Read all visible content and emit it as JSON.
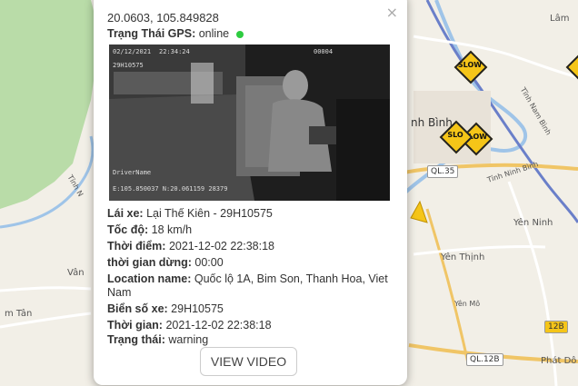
{
  "map": {
    "labels": {
      "lam": "Lâm",
      "binh": "nh Bình",
      "tinh_nam_binh": "Tĩnh Nam Bình",
      "tinh_ninh_binh": "Tỉnh Ninh Bình",
      "tinh_n": "Tỉnh N",
      "yen_ninh": "Yên Ninh",
      "yen_thinh": "Yên Thịnh",
      "van": "Vân",
      "m_tan": "m Tân",
      "yen_mo": "Yên Mô",
      "phat_do": "Phát Dô"
    },
    "roads": {
      "ql35": "QL.35",
      "ql12b": "QL.12B",
      "ql12b_short": "QL.12B"
    },
    "signs": {
      "slow1": "SLOW",
      "slow2": "SLOW",
      "slow3": "SLO"
    }
  },
  "popup": {
    "coords": "20.0603, 105.849828",
    "gps_label": "Trạng Thái GPS:",
    "gps_value": "online",
    "camera": {
      "date": "02/12/2021",
      "time": "22:34:24",
      "channel": "00004",
      "plate": "29H10575",
      "driver": "DriverName",
      "gps_text": "E:105.850037 N:20.061159 28379"
    },
    "driver_label": "Lái xe:",
    "driver_value": "Lại Thế Kiên - 29H10575",
    "speed_label": "Tốc độ:",
    "speed_value": "18 km/h",
    "time_label": "Thời điểm:",
    "time_value": "2021-12-02 22:38:18",
    "stop_label": "thời gian dừng:",
    "stop_value": "00:00",
    "location_label": "Location name:",
    "location_value_1": "Quốc lộ 1A, Bim Son, Thanh Hoa, Viet",
    "location_value_2": "Nam",
    "plate_label": "Biển số xe:",
    "plate_value": "29H10575",
    "time2_label": "Thời gian:",
    "time2_value": "2021-12-02 22:38:18",
    "status_label": "Trạng thái:",
    "status_value": "warning",
    "view_video": "VIEW VIDEO",
    "close": "×"
  }
}
